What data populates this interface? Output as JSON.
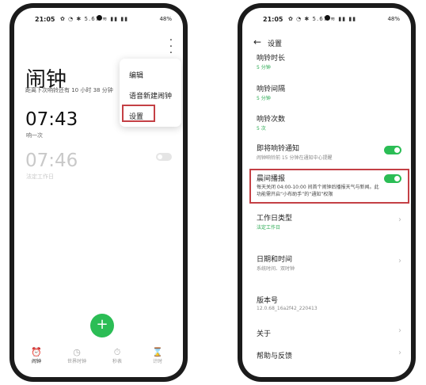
{
  "left": {
    "status": {
      "time": "21:05",
      "icons": "✿ ◔ ✱ 5.67 ≋ ▮▮ ▮▮",
      "battery": "48%"
    },
    "title": "闹钟",
    "subtitle": "距离下次响铃还有 10 小时 38 分钟",
    "alarms": [
      {
        "time": "07:43",
        "sub": "响一次",
        "enabled": true
      },
      {
        "time": "07:46",
        "sub": "法定工作日",
        "enabled": false
      }
    ],
    "menu": {
      "items": [
        "编辑",
        "语音新建闹钟",
        "设置"
      ],
      "highlighted": "设置"
    },
    "fab_icon": "+",
    "tabs": [
      {
        "label": "闹钟",
        "icon": "alarm-clock-icon",
        "glyph": "⏰",
        "active": true
      },
      {
        "label": "世界时钟",
        "icon": "world-clock-icon",
        "glyph": "◷",
        "active": false
      },
      {
        "label": "秒表",
        "icon": "stopwatch-icon",
        "glyph": "⏱",
        "active": false
      },
      {
        "label": "计时",
        "icon": "hourglass-icon",
        "glyph": "⌛",
        "active": false
      }
    ]
  },
  "right": {
    "status": {
      "time": "21:05",
      "icons": "✿ ◔ ✱ 5.67 ≋ ▮▮ ▮▮",
      "battery": "48%"
    },
    "back_icon": "←",
    "header_title": "设置",
    "rows": {
      "ring_duration": {
        "title": "响铃时长",
        "sub": "5 分钟"
      },
      "ring_interval": {
        "title": "响铃间隔",
        "sub": "5 分钟"
      },
      "ring_count": {
        "title": "响铃次数",
        "sub": "5 次"
      },
      "upcoming_notice": {
        "title": "即将响铃通知",
        "sub": "闹钟响铃前 15 分钟在通知中心提醒",
        "toggle": true
      },
      "morning_broadcast": {
        "title": "晨间播报",
        "desc": "每天关闭 04:00-10:00 间首个闹钟后播报天气与新闻。此功能需开启“小布助手”的“通知”权限",
        "toggle": true
      },
      "workday_type": {
        "title": "工作日类型",
        "sub": "法定工作日"
      },
      "date_time": {
        "title": "日期和时间",
        "sub": "系统时间、双时钟"
      },
      "version": {
        "title": "版本号",
        "sub": "12.0.68_16a2f42_220413"
      },
      "about": {
        "title": "关于"
      },
      "help": {
        "title": "帮助与反馈"
      }
    },
    "chevron": "›",
    "accent_color": "#2bbd55",
    "highlight_color": "#c44045"
  }
}
